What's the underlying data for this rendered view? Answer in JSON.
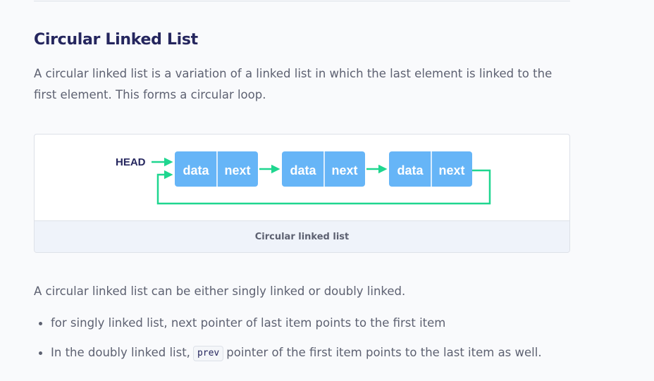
{
  "section": {
    "title": "Circular Linked List",
    "intro": "A circular linked list is a variation of a linked list in which the last element is linked to the first element. This forms a circular loop."
  },
  "figure": {
    "head_label": "HEAD",
    "nodes": [
      {
        "data": "data",
        "next": "next"
      },
      {
        "data": "data",
        "next": "next"
      },
      {
        "data": "data",
        "next": "next"
      }
    ],
    "caption": "Circular linked list",
    "colors": {
      "node": "#66b5f7",
      "arrow": "#1fd68f",
      "node_text": "#ffffff"
    }
  },
  "body": {
    "para": "A circular linked list can be either singly linked or doubly linked.",
    "bullets": [
      {
        "text": "for singly linked list, next pointer of last item points to the first item"
      },
      {
        "before": "In the doubly linked list,",
        "code": "prev",
        "after": "pointer of the first item points to the last item as well."
      }
    ]
  }
}
